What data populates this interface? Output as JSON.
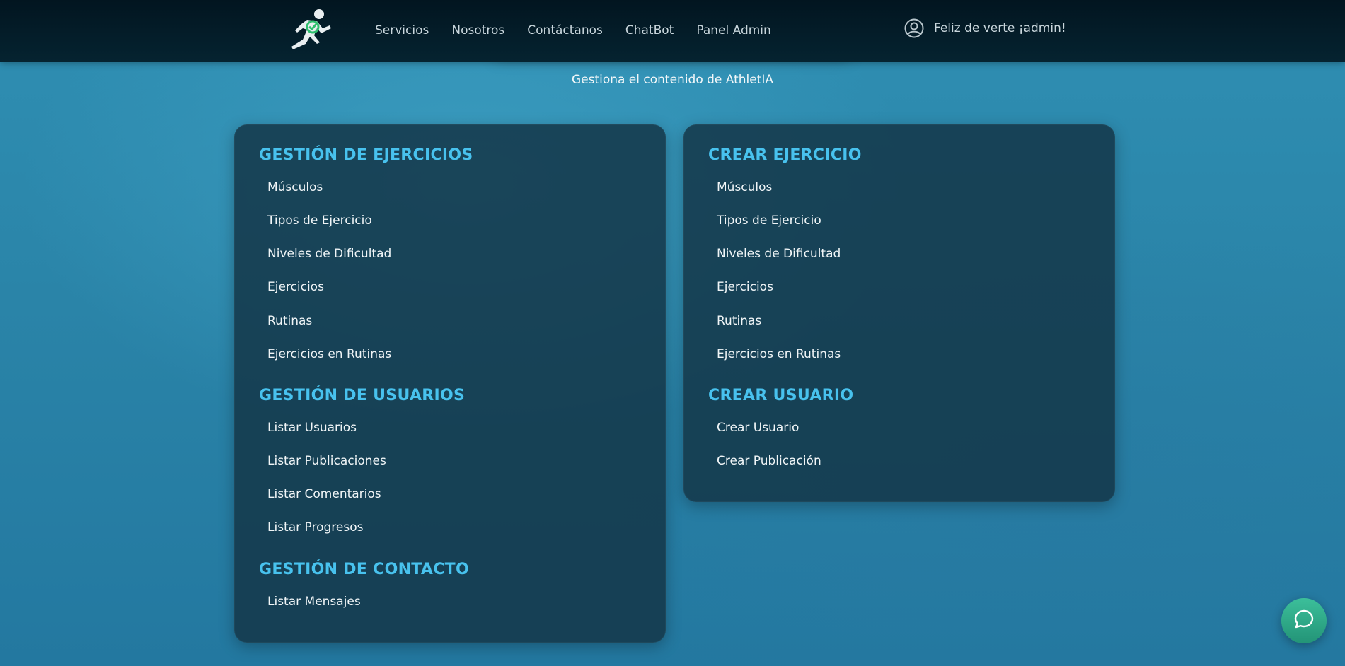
{
  "header": {
    "logo_icon": "runner-logo-icon",
    "nav": [
      {
        "label": "Servicios"
      },
      {
        "label": "Nosotros"
      },
      {
        "label": "Contáctanos"
      },
      {
        "label": "ChatBot"
      },
      {
        "label": "Panel Admin"
      }
    ],
    "user": {
      "icon": "user-circle-icon",
      "greeting": "Feliz de verte ¡admin!"
    }
  },
  "page": {
    "subtitle": "Gestiona el contenido de AthletIA"
  },
  "left_card": {
    "sections": [
      {
        "title": "GESTIÓN DE EJERCICIOS",
        "links": [
          "Músculos",
          "Tipos de Ejercicio",
          "Niveles de Dificultad",
          "Ejercicios",
          "Rutinas",
          "Ejercicios en Rutinas"
        ]
      },
      {
        "title": "GESTIÓN DE USUARIOS",
        "links": [
          "Listar Usuarios",
          "Listar Publicaciones",
          "Listar Comentarios",
          "Listar Progresos"
        ]
      },
      {
        "title": "GESTIÓN DE CONTACTO",
        "links": [
          "Listar Mensajes"
        ]
      }
    ]
  },
  "right_card": {
    "sections": [
      {
        "title": "CREAR EJERCICIO",
        "links": [
          "Músculos",
          "Tipos de Ejercicio",
          "Niveles de Dificultad",
          "Ejercicios",
          "Rutinas",
          "Ejercicios en Rutinas"
        ]
      },
      {
        "title": "CREAR USUARIO",
        "links": [
          "Crear Usuario",
          "Crear Publicación"
        ]
      }
    ]
  },
  "chat_fab": {
    "icon": "chat-bubble-icon"
  },
  "colors": {
    "accent": "#48c2ee",
    "header_bg": "#021520",
    "chat_fab": "#2fae89"
  }
}
